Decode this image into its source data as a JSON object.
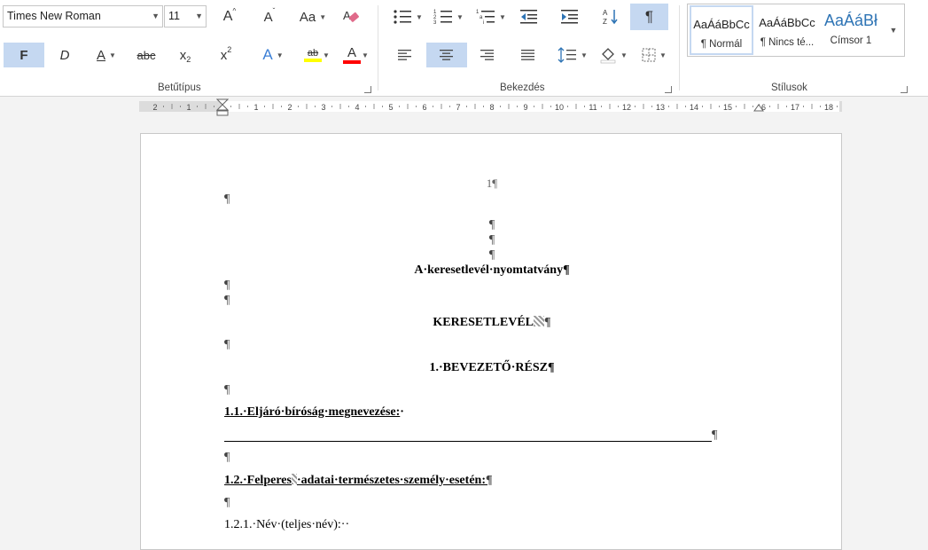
{
  "font": {
    "name": "Times New Roman",
    "size": "11"
  },
  "font_buttons": {
    "grow": "A",
    "shrink": "A",
    "case": "Aa",
    "bold": "F",
    "italic": "D",
    "underline": "A",
    "strike": "abc",
    "subscript": "x",
    "sub_index": "2",
    "superscript": "x",
    "sup_index": "2",
    "effects": "A",
    "highlight": "ab",
    "font_color": "A"
  },
  "paragraph_buttons": {
    "show_marks": "¶"
  },
  "groups": {
    "font": "Betűtípus",
    "paragraph": "Bekezdés",
    "styles": "Stílusok"
  },
  "styles": [
    {
      "preview": "AaÁáBbCc",
      "name": "¶ Normál"
    },
    {
      "preview": "AaÁáBbCc",
      "name": "¶ Nincs té..."
    },
    {
      "preview": "AaÁáBł",
      "name": "Címsor 1"
    }
  ],
  "ruler_ticks": [
    "2",
    "1",
    "1",
    "2",
    "3",
    "4",
    "5",
    "6",
    "7",
    "8",
    "9",
    "10",
    "11",
    "12",
    "13",
    "14",
    "15",
    "16",
    "17",
    "18"
  ],
  "colors": {
    "accent": "#c5d8f1",
    "highlight": "#ffff00",
    "font_color": "#ff0000",
    "heading_blue": "#2e74b5"
  },
  "document": {
    "page_number": "1¶",
    "mark": "¶",
    "title": "A·keresetlevél·nyomtatvány¶",
    "heading": "KERESETLEVÉL",
    "section1": "1.·BEVEZETŐ·RÉSZ¶",
    "sub11": "1.1.·Eljáró·bíróság·megnevezése:",
    "sub11_tail": "·",
    "sub12": "1.2.·Felperes",
    "sub12_rest": "·adatai·természetes·személy·esetén:",
    "item121": "1.2.1.·Név·(teljes·név):··"
  }
}
